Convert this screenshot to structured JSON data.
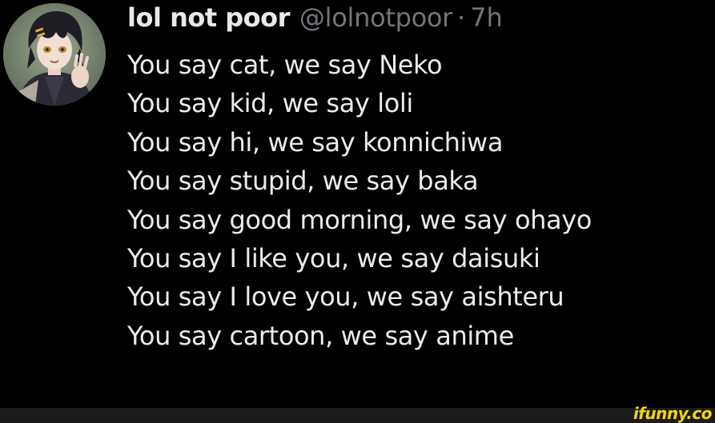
{
  "tweet": {
    "display_name": "lol not poor",
    "handle": "@lolnotpoor",
    "separator": "·",
    "time": "7h",
    "lines": [
      "You say cat, we say Neko",
      "You say kid, we say loli",
      "You say hi, we say konnichiwa",
      "You say stupid, we say baka",
      "You say good morning, we say ohayo",
      "You say I like you, we say daisuki",
      "You say I love you, we say aishteru",
      "You say cartoon, we say anime"
    ]
  },
  "watermark": {
    "text": "ifunny.co"
  },
  "colors": {
    "background": "#000000",
    "primary_text": "#e7e9ea",
    "secondary_text": "#71767b",
    "watermark": "#f5d40d"
  }
}
